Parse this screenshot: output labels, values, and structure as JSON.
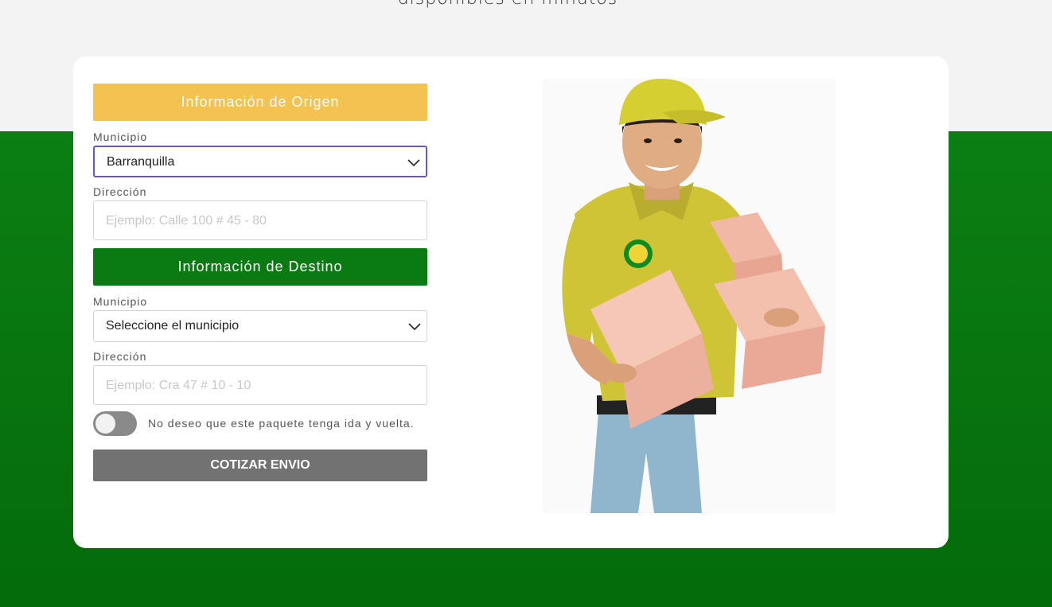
{
  "hero": {
    "subtitle": "disponibles en minutos"
  },
  "origin": {
    "header": "Información de Origen",
    "municipio_label": "Municipio",
    "municipio_value": "Barranquilla",
    "direccion_label": "Dirección",
    "direccion_placeholder": "Ejemplo: Calle 100 # 45 - 80"
  },
  "destination": {
    "header": "Información de Destino",
    "municipio_label": "Municipio",
    "municipio_value": "Seleccione el municipio",
    "direccion_label": "Dirección",
    "direccion_placeholder": "Ejemplo: Cra 47 # 10 - 10"
  },
  "round_trip": {
    "label": "No deseo que este paquete tenga ida y vuelta.",
    "on": false
  },
  "submit": {
    "label": "COTIZAR ENVIO"
  },
  "colors": {
    "origin_header": "#f4c251",
    "destination_header": "#0a7a13",
    "background_green": "#0b7f13",
    "button_gray": "#727272",
    "focus_border": "#6a55c8"
  },
  "icons": {
    "select_arrow": "chevron-down-icon",
    "image": "delivery-person-with-boxes"
  }
}
